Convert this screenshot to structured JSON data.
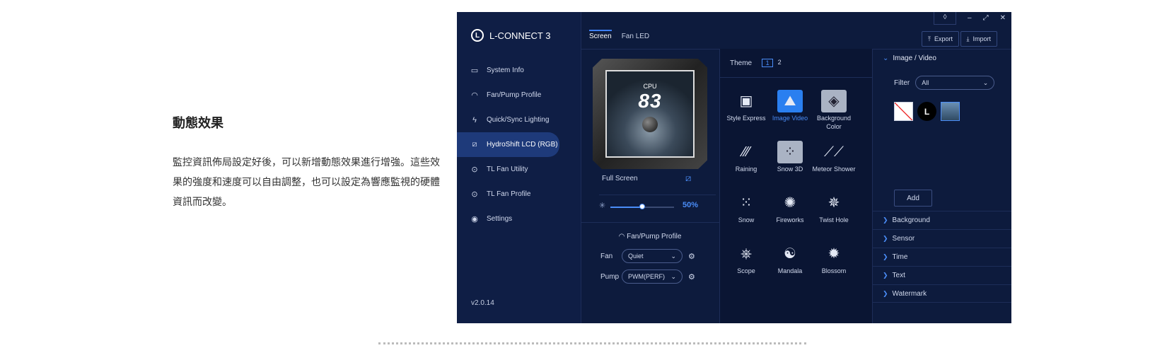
{
  "article": {
    "title": "動態效果",
    "body": "監控資訊佈局設定好後，可以新增動態效果進行增強。這些效果的強度和速度可以自由調整，也可以設定為響應監視的硬體資訊而改變。"
  },
  "app": {
    "brand": "L-CONNECT 3",
    "version": "v2.0.14",
    "nav": [
      {
        "label": "System Info",
        "icon": "monitor-icon"
      },
      {
        "label": "Fan/Pump Profile",
        "icon": "gauge-icon"
      },
      {
        "label": "Quick/Sync Lighting",
        "icon": "lightning-icon"
      },
      {
        "label": "HydroShift LCD (RGB)",
        "icon": "lcd-icon",
        "active": true
      },
      {
        "label": "TL Fan Utility",
        "icon": "fan-icon"
      },
      {
        "label": "TL Fan Profile",
        "icon": "fan-profile-icon"
      },
      {
        "label": "Settings",
        "icon": "settings-icon"
      }
    ],
    "tabs": [
      {
        "label": "Screen",
        "active": true
      },
      {
        "label": "Fan LED",
        "active": false
      }
    ],
    "export_label": "Export",
    "import_label": "Import",
    "preview": {
      "cpu_label": "CPU",
      "cpu_value": "83",
      "fullscreen_label": "Full Screen",
      "brightness": "50%",
      "brightness_level": 0.5
    },
    "fan_pump": {
      "title": "Fan/Pump Profile",
      "fan_label": "Fan",
      "fan_value": "Quiet",
      "pump_label": "Pump",
      "pump_value": "PWM(PERF)"
    },
    "theme": {
      "label": "Theme",
      "pages": [
        "1",
        "2"
      ],
      "effects": [
        {
          "label": "Style Express",
          "icon": "style-express-icon"
        },
        {
          "label": "Image Video",
          "icon": "image-video-icon",
          "selected": true
        },
        {
          "label": "Background Color",
          "icon": "background-color-icon"
        },
        {
          "label": "Raining",
          "icon": "raining-icon"
        },
        {
          "label": "Snow 3D",
          "icon": "snow-3d-icon"
        },
        {
          "label": "Meteor Shower",
          "icon": "meteor-shower-icon"
        },
        {
          "label": "Snow",
          "icon": "snow-icon"
        },
        {
          "label": "Fireworks",
          "icon": "fireworks-icon"
        },
        {
          "label": "Twist Hole",
          "icon": "twist-hole-icon"
        },
        {
          "label": "Scope",
          "icon": "scope-icon"
        },
        {
          "label": "Mandala",
          "icon": "mandala-icon"
        },
        {
          "label": "Blossom",
          "icon": "blossom-icon"
        }
      ]
    },
    "panel": {
      "section_title": "Image / Video",
      "filter_label": "Filter",
      "filter_value": "All",
      "add_label": "Add",
      "accordion": [
        "Background",
        "Sensor",
        "Time",
        "Text",
        "Watermark"
      ]
    }
  }
}
